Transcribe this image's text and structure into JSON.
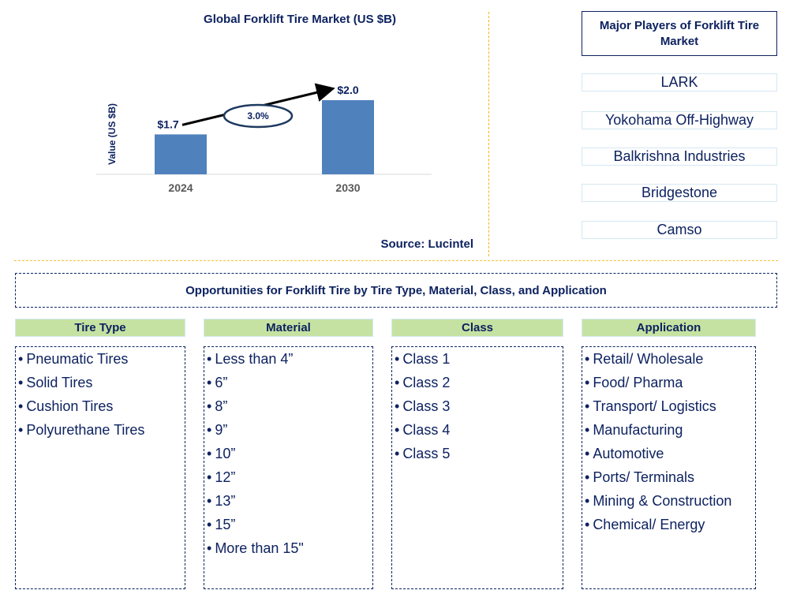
{
  "chart_data": {
    "type": "bar",
    "title": "Global Forklift Tire Market (US $B)",
    "xlabel": "",
    "ylabel": "Value (US $B)",
    "categories": [
      "2024",
      "2030"
    ],
    "values": [
      1.7,
      2.0
    ],
    "data_labels": [
      "$1.7",
      "$2.0"
    ],
    "annotation": {
      "type": "cagr-arrow",
      "label": "3.0%"
    },
    "grid": false,
    "legend": "none",
    "bar_color": "#4f81bd"
  },
  "source": "Source: Lucintel",
  "players": {
    "header": "Major Players of Forklift Tire Market",
    "items": [
      "LARK",
      "Yokohama Off-Highway",
      "Balkrishna Industries",
      "Bridgestone",
      "Camso"
    ]
  },
  "opportunities": {
    "title": "Opportunities for Forklift Tire by Tire Type, Material, Class, and Application",
    "bullet": "•",
    "categories": [
      {
        "name": "Tire Type",
        "items": [
          "Pneumatic Tires",
          "Solid Tires",
          "Cushion Tires",
          "Polyurethane Tires"
        ]
      },
      {
        "name": "Material",
        "items": [
          "Less than 4”",
          "6”",
          "8”",
          "9”",
          "10”",
          "12”",
          "13”",
          "15”",
          "More than 15\""
        ]
      },
      {
        "name": "Class",
        "items": [
          "Class 1",
          "Class 2",
          "Class 3",
          "Class 4",
          "Class 5"
        ]
      },
      {
        "name": "Application",
        "items": [
          "Retail/ Wholesale",
          "Food/ Pharma",
          "Transport/ Logistics",
          "Manufacturing",
          "Automotive",
          "Ports/ Terminals",
          "Mining & Construction",
          "Chemical/ Energy"
        ]
      }
    ]
  },
  "colors": {
    "text": "#0d2260",
    "bar": "#4f81bd",
    "category_header": "#c6e2a2",
    "divider": "#f5b800"
  }
}
